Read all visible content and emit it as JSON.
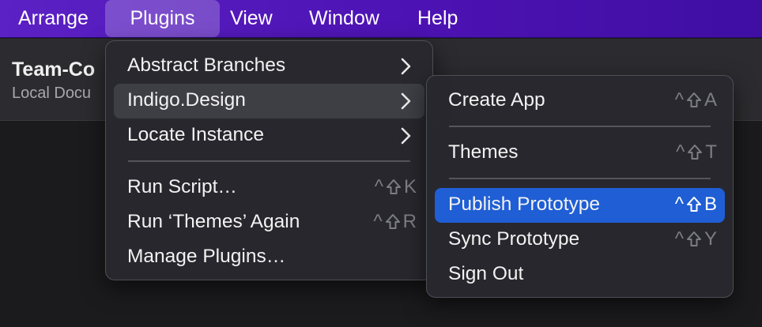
{
  "menubar": {
    "items": [
      {
        "label": "Arrange"
      },
      {
        "label": "Plugins"
      },
      {
        "label": "View"
      },
      {
        "label": "Window"
      },
      {
        "label": "Help"
      }
    ]
  },
  "document": {
    "title": "Team-Co",
    "subtitle": "Local Docu"
  },
  "plugins_menu": {
    "items": [
      {
        "label": "Abstract Branches",
        "submenu": true
      },
      {
        "label": "Indigo.Design",
        "submenu": true
      },
      {
        "label": "Locate Instance",
        "submenu": true
      },
      {
        "label": "Run Script…",
        "shortcut_key": "K"
      },
      {
        "label": "Run ‘Themes’ Again",
        "shortcut_key": "R"
      },
      {
        "label": "Manage Plugins…"
      }
    ]
  },
  "indigo_submenu": {
    "items": [
      {
        "label": "Create App",
        "shortcut_key": "A"
      },
      {
        "label": "Themes",
        "shortcut_key": "T"
      },
      {
        "label": "Publish Prototype",
        "shortcut_key": "B"
      },
      {
        "label": "Sync Prototype",
        "shortcut_key": "Y"
      },
      {
        "label": "Sign Out"
      }
    ]
  },
  "shortcut_modifiers": {
    "control": "^",
    "shift": "⇧"
  },
  "colors": {
    "menubar": "#5b21c4",
    "selection": "#1f5ed4",
    "menu_bg": "#28282e",
    "shortcut_dim": "#7d7d84"
  }
}
